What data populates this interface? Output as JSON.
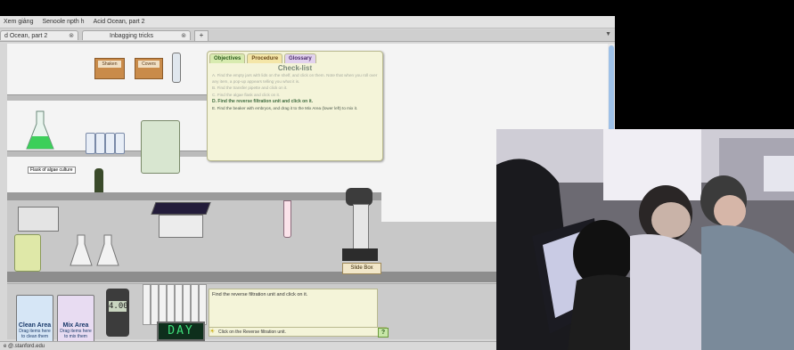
{
  "browser": {
    "bookmarks": [
      "Xem giảng",
      "Senoole npth h",
      "Acid Ocean, part 2"
    ],
    "tabs": [
      {
        "title": "d Ocean, part 2",
        "close": "⊗"
      },
      {
        "title": "Inbagging tricks",
        "close": "⊗"
      }
    ],
    "new_tab": "+",
    "status_text": "e @.stanford.edu"
  },
  "checklist": {
    "tabs": [
      "Objectives",
      "Procedure",
      "Glossary"
    ],
    "title": "Check-list",
    "items": [
      "A. Find the empty jars with lids on the shelf, and click on them. Note that when you roll over any item, a pop-up appears telling you what it is.",
      "B. Find the transfer pipette and click on it.",
      "C. Find the algae flask and click on it.",
      "D. Find the reverse filtration unit and click on it.",
      "E. Find the beaker with embryos, and drag it to the Mix Area (lower left) to mix it."
    ]
  },
  "lab": {
    "box_labels": [
      "Shaken",
      "Covers"
    ],
    "flask_tag": "Flask of algae culture",
    "slide_box": "Slide Box"
  },
  "bottom": {
    "clean_area": {
      "title": "Clean Area",
      "sub": "Drag items here to clean them"
    },
    "mix_area": {
      "title": "Mix Area",
      "sub": "Drag items here to mix them"
    },
    "meter_value": "4.00",
    "day_display": "DAY",
    "task_text": "Find the reverse filtration unit and click on it.",
    "hint_text": "Click on the Reverse filtration unit.",
    "help": "?"
  },
  "colors": {
    "accent_green": "#3d6a3d",
    "day_led": "#3ee07a"
  }
}
